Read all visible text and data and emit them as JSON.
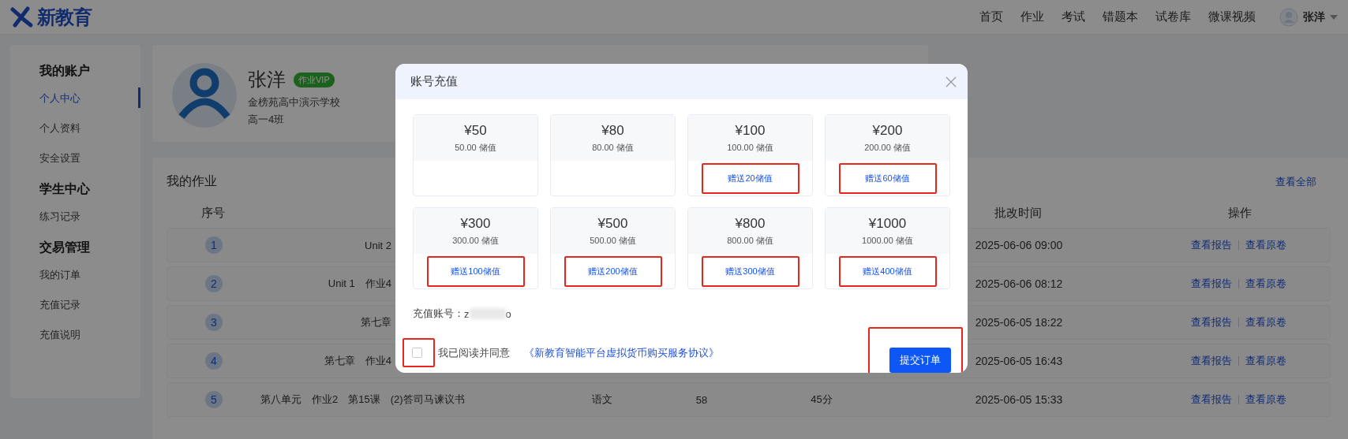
{
  "header": {
    "logo_text": "新教育",
    "nav": [
      {
        "label": "首页"
      },
      {
        "label": "作业"
      },
      {
        "label": "考试"
      },
      {
        "label": "错题本"
      },
      {
        "label": "试卷库"
      },
      {
        "label": "微课视频"
      }
    ],
    "user": {
      "name": "张洋"
    }
  },
  "sidebar": {
    "sections": [
      {
        "title": "我的账户",
        "items": [
          {
            "label": "个人中心",
            "selected": true
          },
          {
            "label": "个人资料",
            "selected": false
          },
          {
            "label": "安全设置",
            "selected": false
          }
        ]
      },
      {
        "title": "学生中心",
        "items": [
          {
            "label": "练习记录",
            "selected": false
          }
        ]
      },
      {
        "title": "交易管理",
        "items": [
          {
            "label": "我的订单",
            "selected": false
          },
          {
            "label": "充值记录",
            "selected": false
          },
          {
            "label": "充值说明",
            "selected": false
          }
        ]
      }
    ]
  },
  "profile": {
    "name": "张洋",
    "badge": "作业VIP",
    "school": "金榜苑高中演示学校",
    "class_name": "高一4班"
  },
  "homework": {
    "title": "我的作业",
    "view_all": "查看全部",
    "header": {
      "index": "序号",
      "graded_time": "批改时间",
      "actions": "操作"
    },
    "rows": [
      {
        "index": "1",
        "name": "Unit 2",
        "graded_time": "2025-06-06 09:00",
        "actions": [
          "查看报告",
          "查看原卷"
        ]
      },
      {
        "index": "2",
        "name": "Unit 1　作业4",
        "graded_time": "2025-06-06 08:12",
        "actions": [
          "查看报告",
          "查看原卷"
        ]
      },
      {
        "index": "3",
        "name": "第七章",
        "graded_time": "2025-06-05 18:22",
        "actions": [
          "查看报告",
          "查看原卷"
        ]
      },
      {
        "index": "4",
        "name": "第七章　作业4",
        "graded_time": "2025-06-05 16:43",
        "actions": [
          "查看报告",
          "查看原卷"
        ]
      },
      {
        "index": "5",
        "name": "第八单元　作业2　第15课　(2)答司马谏议书",
        "subject": "语文",
        "score": "58",
        "duration": "45分",
        "graded_time": "2025-06-05 15:33",
        "actions": [
          "查看报告",
          "查看原卷"
        ]
      }
    ]
  },
  "modal": {
    "title": "账号充值",
    "packages": [
      {
        "price": "¥50",
        "value": "50.00 储值"
      },
      {
        "price": "¥80",
        "value": "80.00 储值"
      },
      {
        "price": "¥100",
        "value": "100.00 储值",
        "bonus": "赠送20储值",
        "annotated": true
      },
      {
        "price": "¥200",
        "value": "200.00 储值",
        "bonus": "赠送60储值",
        "annotated": true
      },
      {
        "price": "¥300",
        "value": "300.00 储值",
        "bonus": "赠送100储值",
        "annotated": true
      },
      {
        "price": "¥500",
        "value": "500.00 储值",
        "bonus": "赠送200储值",
        "annotated": true
      },
      {
        "price": "¥800",
        "value": "800.00 储值",
        "bonus": "赠送300储值",
        "annotated": true
      },
      {
        "price": "¥1000",
        "value": "1000.00 储值",
        "bonus": "赠送400储值",
        "annotated": true
      }
    ],
    "account": {
      "label": "充值账号：",
      "value_start": "z",
      "value_end": "o"
    },
    "agreement": {
      "checked": false,
      "annotated": true,
      "text": "我已阅读并同意",
      "link": "《新教育智能平台虚拟货币购买服务协议》"
    },
    "submit": {
      "label": "提交订单",
      "annotated": true
    }
  }
}
